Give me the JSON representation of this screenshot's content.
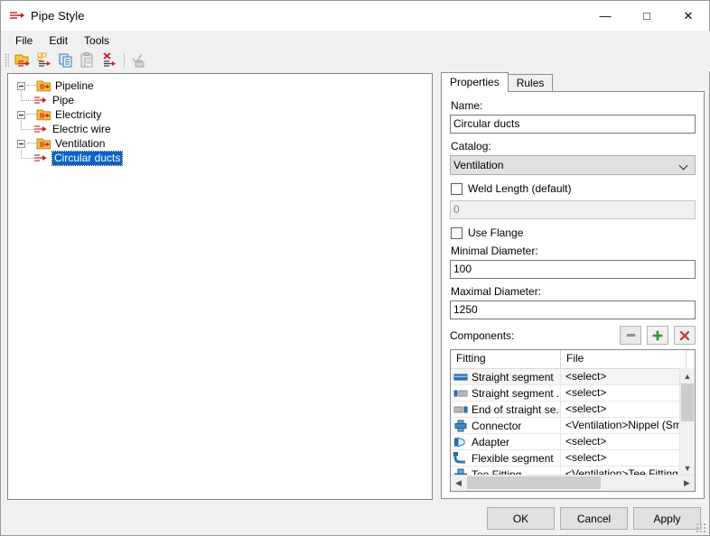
{
  "window": {
    "title": "Pipe Style",
    "icon": "pipe-style-icon",
    "controls": {
      "minimize": "—",
      "maximize": "□",
      "close": "✕"
    }
  },
  "menubar": {
    "items": [
      {
        "label": "File"
      },
      {
        "label": "Edit"
      },
      {
        "label": "Tools"
      }
    ]
  },
  "toolbar": {
    "buttons": [
      {
        "name": "new-style-icon"
      },
      {
        "name": "new-pipe-icon"
      },
      {
        "name": "copy-icon"
      },
      {
        "name": "paste-icon"
      },
      {
        "name": "delete-pipe-icon"
      },
      {
        "name": "check-apply-icon"
      }
    ]
  },
  "tree": {
    "nodes": [
      {
        "label": "Pipeline",
        "type": "folder",
        "expanded": true,
        "selected": false
      },
      {
        "label": "Pipe",
        "type": "pipe",
        "child": true,
        "selected": false
      },
      {
        "label": "Electricity",
        "type": "folder",
        "expanded": true,
        "selected": false
      },
      {
        "label": "Electric wire",
        "type": "pipe",
        "child": true,
        "selected": false
      },
      {
        "label": "Ventilation",
        "type": "folder",
        "expanded": true,
        "selected": false
      },
      {
        "label": "Circular ducts",
        "type": "pipe",
        "child": true,
        "selected": true
      }
    ]
  },
  "properties": {
    "tabs": [
      {
        "label": "Properties",
        "active": true
      },
      {
        "label": "Rules",
        "active": false
      }
    ],
    "name_label": "Name:",
    "name_value": "Circular ducts",
    "catalog_label": "Catalog:",
    "catalog_value": "Ventilation",
    "weld_length_label": "Weld Length (default)",
    "weld_length_checked": false,
    "weld_length_value": "0",
    "use_flange_label": "Use Flange",
    "use_flange_checked": false,
    "min_diameter_label": "Minimal Diameter:",
    "min_diameter_value": "100",
    "max_diameter_label": "Maximal Diameter:",
    "max_diameter_value": "1250",
    "components_label": "Components:",
    "component_buttons": {
      "remove": "–",
      "add": "+",
      "delete": "✖"
    },
    "components_columns": [
      "Fitting",
      "File"
    ],
    "components_rows": [
      {
        "fitting": "Straight segment",
        "file": "<select>",
        "icon": "straight-segment-icon"
      },
      {
        "fitting": "Straight segment ...",
        "file": "<select>",
        "icon": "straight-segment-start-icon"
      },
      {
        "fitting": "End of straight se...",
        "file": "<select>",
        "icon": "straight-segment-end-icon"
      },
      {
        "fitting": "Connector",
        "file": "<Ventilation>Nippel (Smart).",
        "icon": "connector-icon"
      },
      {
        "fitting": "Adapter",
        "file": "<select>",
        "icon": "adapter-icon"
      },
      {
        "fitting": "Flexible segment",
        "file": "<select>",
        "icon": "flexible-segment-icon"
      },
      {
        "fitting": "Tee Fitting",
        "file": "<Ventilation>Tee Fitting (Sm",
        "icon": "tee-fitting-icon"
      }
    ]
  },
  "dialog_buttons": {
    "ok": "OK",
    "cancel": "Cancel",
    "apply": "Apply"
  },
  "colors": {
    "accent_selection": "#0a64c8",
    "window_bg": "#f0f0f0",
    "icon_red": "#d11a1a",
    "icon_yellow": "#f5c242",
    "icon_blue": "#2f77b5",
    "add_green": "#35a035",
    "delete_red": "#d42a2a"
  }
}
